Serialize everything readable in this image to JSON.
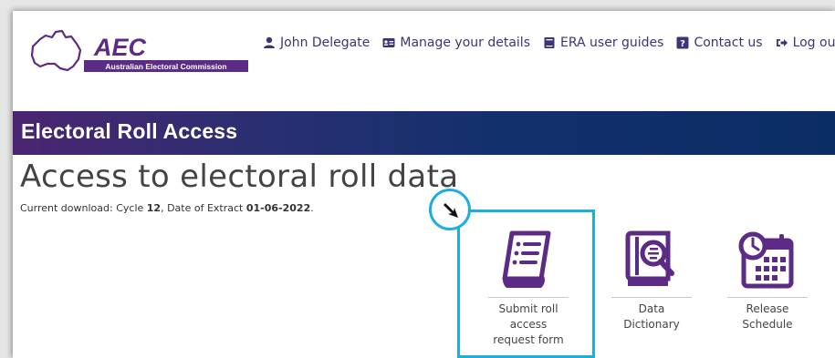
{
  "header": {
    "logo_text": "AEC",
    "logo_subtitle": "Australian Electoral Commission",
    "nav": [
      {
        "label": "John Delegate",
        "icon": "user-icon"
      },
      {
        "label": "Manage your details",
        "icon": "id-card-icon"
      },
      {
        "label": "ERA user guides",
        "icon": "book-icon"
      },
      {
        "label": "Contact us",
        "icon": "question-icon"
      },
      {
        "label": "Log out",
        "icon": "logout-icon"
      }
    ]
  },
  "banner": {
    "title": "Electoral Roll Access"
  },
  "main": {
    "title": "Access to electoral roll data",
    "download": {
      "prefix": "Current download: Cycle ",
      "cycle": "12",
      "middle": ", Date of Extract ",
      "date": "01-06-2022",
      "suffix": "."
    },
    "tiles": [
      {
        "label": "Submit roll access request form",
        "icon": "form-document-icon"
      },
      {
        "label": "Data Dictionary",
        "icon": "dictionary-book-icon"
      },
      {
        "label": "Release Schedule",
        "icon": "calendar-clock-icon"
      }
    ]
  },
  "colors": {
    "accent": "#1eaede",
    "brand": "#5b2b86",
    "nav_text": "#3b3578"
  }
}
